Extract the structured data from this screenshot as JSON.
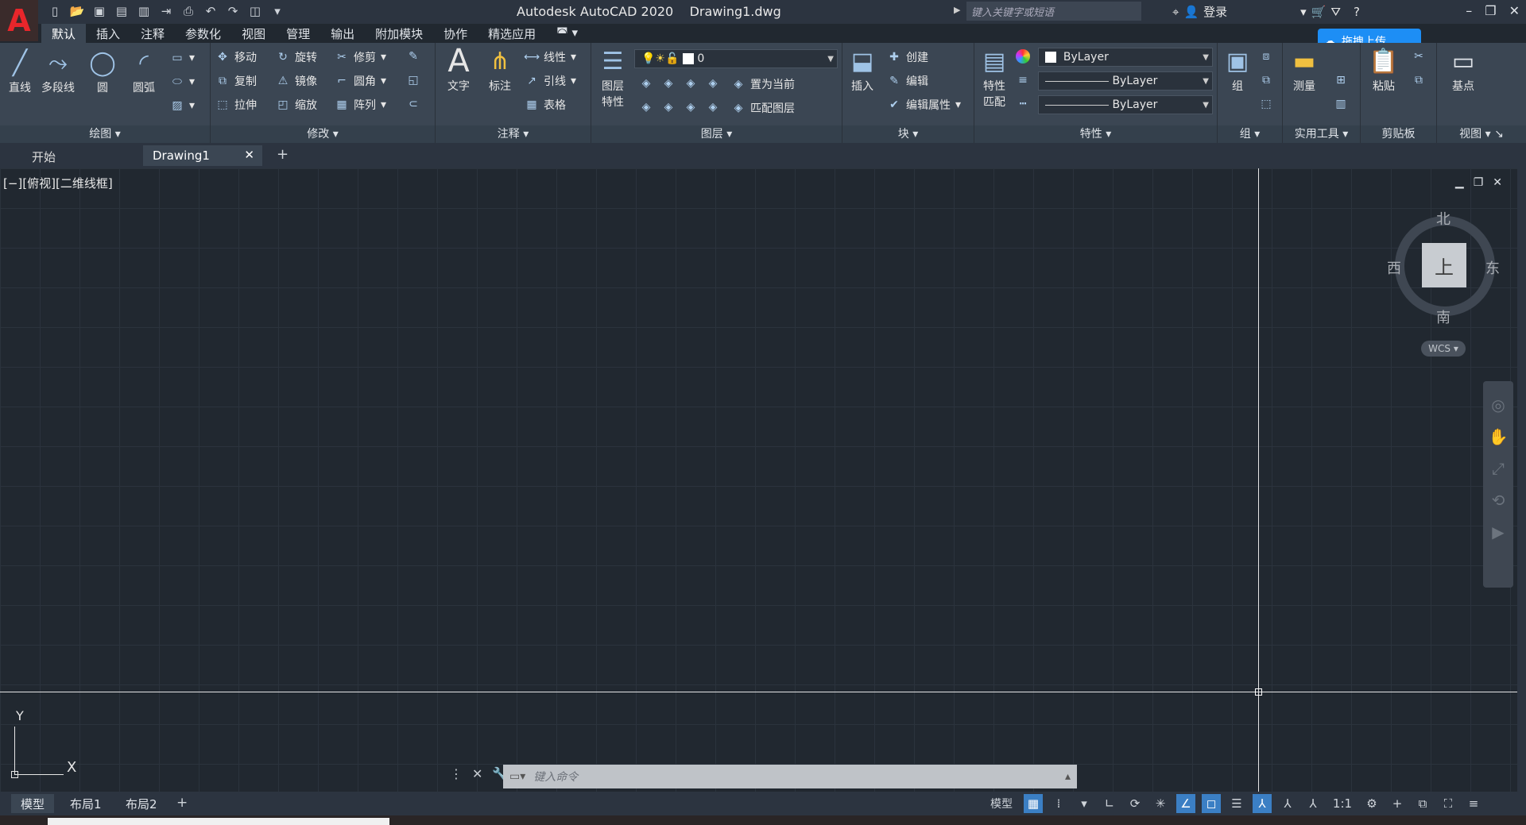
{
  "app": {
    "logo_letter": "A",
    "title": "Autodesk AutoCAD 2020",
    "document": "Drawing1.dwg"
  },
  "search": {
    "placeholder": "键入关键字或短语"
  },
  "user": {
    "login": "登录"
  },
  "ribbon_tabs": [
    "默认",
    "插入",
    "注释",
    "参数化",
    "视图",
    "管理",
    "输出",
    "附加模块",
    "协作",
    "精选应用"
  ],
  "baidu": {
    "label": "拖拽上传"
  },
  "draw": {
    "title": "绘图",
    "line": "直线",
    "polyline": "多段线",
    "circle": "圆",
    "arc": "圆弧"
  },
  "modify": {
    "title": "修改",
    "move": "移动",
    "rotate": "旋转",
    "trim": "修剪",
    "copy": "复制",
    "mirror": "镜像",
    "fillet": "圆角",
    "stretch": "拉伸",
    "scale": "缩放",
    "array": "阵列"
  },
  "annotation": {
    "title": "注释",
    "text": "文字",
    "dimension": "标注",
    "linear": "线性",
    "leader": "引线",
    "table": "表格"
  },
  "layers": {
    "title": "图层",
    "properties": "图层\n特性",
    "layer_value": "0",
    "set_current": "置为当前",
    "match_layer": "匹配图层"
  },
  "block": {
    "title": "块",
    "insert": "插入",
    "create": "创建",
    "edit": "编辑",
    "edit_attr": "编辑属性"
  },
  "properties": {
    "title": "特性",
    "match": "特性\n匹配",
    "color": "ByLayer",
    "linetype": "ByLayer",
    "lineweight": "ByLayer"
  },
  "groups": {
    "title": "组",
    "group": "组"
  },
  "utilities": {
    "title": "实用工具",
    "measure": "测量"
  },
  "clipboard": {
    "title": "剪贴板",
    "paste": "粘贴"
  },
  "view": {
    "title": "视图",
    "base": "基点"
  },
  "file_tabs": {
    "start": "开始",
    "drawing": "Drawing1"
  },
  "viewport": {
    "label": "[−][俯视][二维线框]"
  },
  "viewcube": {
    "north": "北",
    "south": "南",
    "east": "东",
    "west": "西",
    "face": "上",
    "wcs": "WCS"
  },
  "ucs": {
    "x": "X",
    "y": "Y"
  },
  "command": {
    "placeholder": "键入命令"
  },
  "layout_tabs": [
    "模型",
    "布局1",
    "布局2"
  ],
  "status": {
    "model": "模型",
    "scale": "1:1"
  }
}
